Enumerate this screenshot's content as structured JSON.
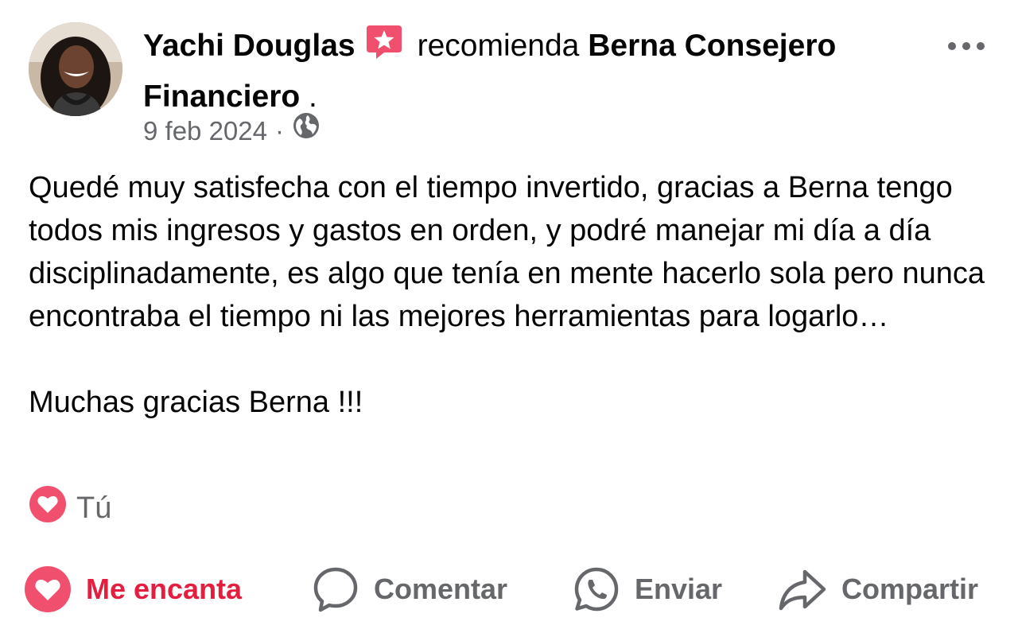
{
  "post": {
    "author": "Yachi Douglas",
    "verb": "recomienda",
    "page_name": "Berna Consejero Financiero",
    "trailing_punct": " .",
    "date": "9 feb 2024",
    "separator": "·",
    "audience_icon": "globe-icon",
    "more_icon": "more-options-icon",
    "body": [
      "Quedé muy satisfecha con el tiempo invertido, gracias a Berna tengo todos mis ingresos y gastos en orden, y podré manejar mi día a día disciplinadamente, es  algo que tenía en mente hacerlo sola pero nunca encontraba el tiempo ni las mejores herramientas para logarlo…",
      "Muchas gracias Berna !!!"
    ]
  },
  "reactions": {
    "icon": "heart-reaction-icon",
    "label": "Tú"
  },
  "actions": {
    "love": {
      "label": "Me encanta",
      "icon": "heart-icon",
      "color": "#e41e3f"
    },
    "comment": {
      "label": "Comentar",
      "icon": "comment-bubble-icon"
    },
    "send": {
      "label": "Enviar",
      "icon": "whatsapp-icon"
    },
    "share": {
      "label": "Compartir",
      "icon": "share-arrow-icon"
    }
  },
  "colors": {
    "love_red": "#e41e3f",
    "secondary_text": "#65676b",
    "recommend_badge": "#f0506e"
  }
}
